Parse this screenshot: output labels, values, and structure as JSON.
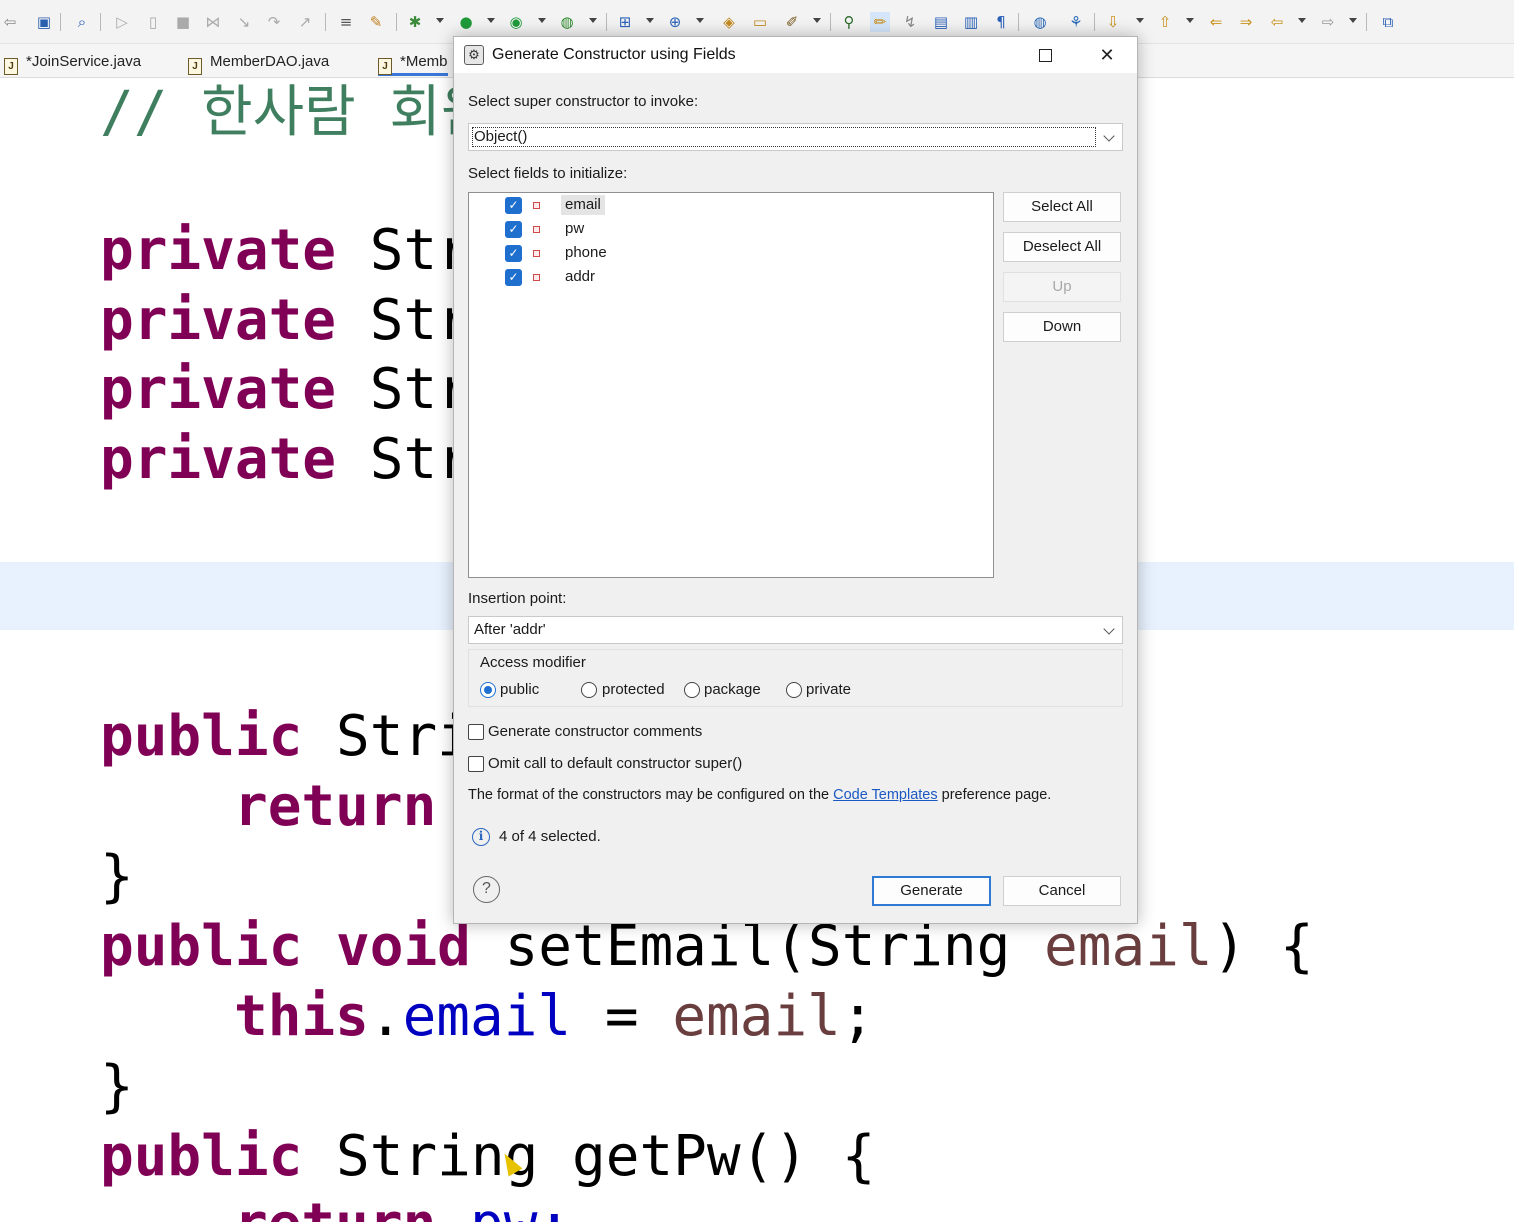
{
  "editor": {
    "tabs": [
      {
        "label": "*JoinService.java"
      },
      {
        "label": "MemberDAO.java"
      },
      {
        "label": "*Memb"
      }
    ],
    "code": {
      "comment": "// 한사람 회원",
      "field_modifier": "private",
      "field_type_partial": "Str",
      "getter_line_public": "public",
      "getter_line_type_partial": "Stri",
      "return_kw": "return",
      "close_brace": "}",
      "setter_public": "public",
      "setter_void": "void",
      "setter_sig": "setEmail(String",
      "setter_param": "email",
      "setter_tail": ") {",
      "this_kw": "this",
      "dot": ".",
      "this_field": "email",
      "assign": " = ",
      "assign_value": "email",
      "semicolon": ";",
      "getpw_public": "public",
      "getpw_sig": "String getPw() {",
      "return_pw_kw": "return",
      "return_pw_val": "pw;"
    }
  },
  "dialog": {
    "title": "Generate Constructor using Fields",
    "super_label": "Select super constructor to invoke:",
    "super_value": "Object()",
    "fields_label": "Select fields to initialize:",
    "fields": [
      {
        "name": "email",
        "checked": true
      },
      {
        "name": "pw",
        "checked": true
      },
      {
        "name": "phone",
        "checked": true
      },
      {
        "name": "addr",
        "checked": true
      }
    ],
    "buttons": {
      "select_all": "Select All",
      "deselect_all": "Deselect All",
      "up": "Up",
      "down": "Down",
      "generate": "Generate",
      "cancel": "Cancel"
    },
    "insertion_label": "Insertion point:",
    "insertion_value": "After 'addr'",
    "access_label": "Access modifier",
    "access_options": [
      {
        "label": "public",
        "selected": true
      },
      {
        "label": "protected",
        "selected": false
      },
      {
        "label": "package",
        "selected": false
      },
      {
        "label": "private",
        "selected": false
      }
    ],
    "gen_comments_label": "Generate constructor comments",
    "omit_super_label": "Omit call to default constructor super()",
    "format_text_before": "The format of the constructors may be configured on the ",
    "format_link": "Code Templates",
    "format_text_after": " preference page.",
    "status_text": "4 of 4 selected."
  },
  "colors": {
    "keyword": "#7f0055",
    "field": "#0000c0",
    "local": "#6a3e3e",
    "comment": "#3f7f5f",
    "accent": "#1f6fcf"
  }
}
